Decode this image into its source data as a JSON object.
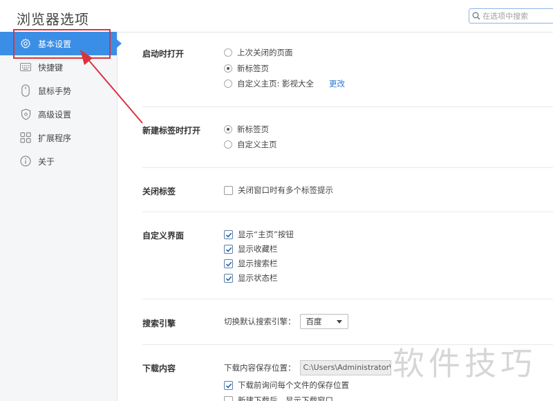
{
  "window": {
    "title": "浏览器选项"
  },
  "search": {
    "placeholder": "在选项中搜索"
  },
  "sidebar": {
    "items": [
      {
        "label": "基本设置",
        "icon": "gear-icon",
        "active": true
      },
      {
        "label": "快捷键",
        "icon": "keyboard-icon"
      },
      {
        "label": "鼠标手势",
        "icon": "mouse-icon"
      },
      {
        "label": "高级设置",
        "icon": "shield-icon"
      },
      {
        "label": "扩展程序",
        "icon": "extensions-icon"
      },
      {
        "label": "关于",
        "icon": "info-icon"
      }
    ]
  },
  "sections": {
    "startup": {
      "title": "启动时打开",
      "options": [
        {
          "label": "上次关闭的页面",
          "selected": false
        },
        {
          "label": "新标签页",
          "selected": true
        },
        {
          "label": "自定义主页: 影视大全",
          "selected": false
        }
      ],
      "change_link": "更改"
    },
    "newtab": {
      "title": "新建标签时打开",
      "options": [
        {
          "label": "新标签页",
          "selected": true
        },
        {
          "label": "自定义主页",
          "selected": false
        }
      ]
    },
    "closetab": {
      "title": "关闭标签",
      "options": [
        {
          "label": "关闭窗口时有多个标签提示",
          "checked": false
        }
      ]
    },
    "ui": {
      "title": "自定义界面",
      "options": [
        {
          "label": "显示“主页”按钮",
          "checked": true
        },
        {
          "label": "显示收藏栏",
          "checked": true
        },
        {
          "label": "显示搜索栏",
          "checked": true
        },
        {
          "label": "显示状态栏",
          "checked": true
        }
      ]
    },
    "search_engine": {
      "title": "搜索引擎",
      "label": "切换默认搜索引擎：",
      "selected": "百度"
    },
    "download": {
      "title": "下载内容",
      "path_label": "下载内容保存位置：",
      "path_value": "C:\\Users\\Administrator\\D",
      "options": [
        {
          "label": "下载前询问每个文件的保存位置",
          "checked": true
        },
        {
          "label": "新建下载后，显示下载窗口",
          "checked": false
        }
      ]
    }
  },
  "watermark": "软件技巧",
  "colors": {
    "accent": "#3b8ee6",
    "annotation": "#d9333f",
    "link": "#2d7bd6"
  }
}
